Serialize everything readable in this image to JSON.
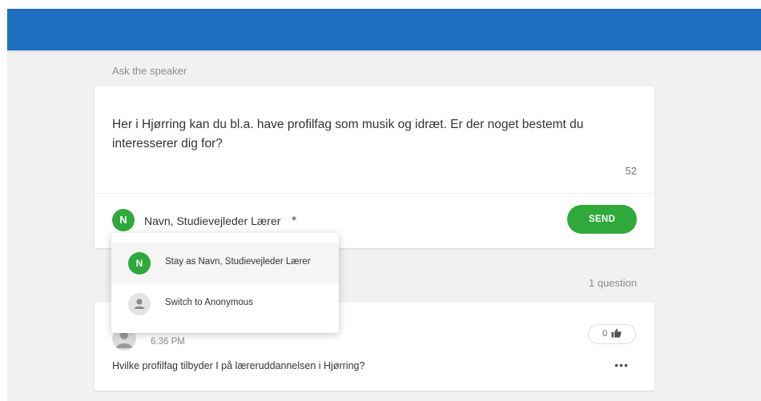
{
  "header": {
    "color": "#1e6fbf"
  },
  "compose": {
    "section_label": "Ask the speaker",
    "question_text": "Her i Hjørring kan du bl.a. have profilfag som musik og idræt. Er der noget bestemt du interesserer dig for?",
    "char_count": "52",
    "author_initial": "N",
    "author_name": "Navn, Studievejleder Lærer",
    "send_label": "SEND",
    "accent_color": "#2fa93a"
  },
  "identity_menu": {
    "items": [
      {
        "initial": "N",
        "label": "Stay as Navn, Studievejleder Lærer",
        "icon": "user-initial-avatar"
      },
      {
        "initial": "",
        "label": "Switch to Anonymous",
        "icon": "person-icon"
      }
    ]
  },
  "questions": {
    "count_label": "1 question",
    "items": [
      {
        "time": "6:36 PM",
        "text": "Hvilke profilfag tilbyder I på læreruddannelsen i Hjørring?",
        "likes": "0",
        "like_icon": "thumbs-up-icon",
        "more_icon": "more-options-icon"
      }
    ]
  }
}
